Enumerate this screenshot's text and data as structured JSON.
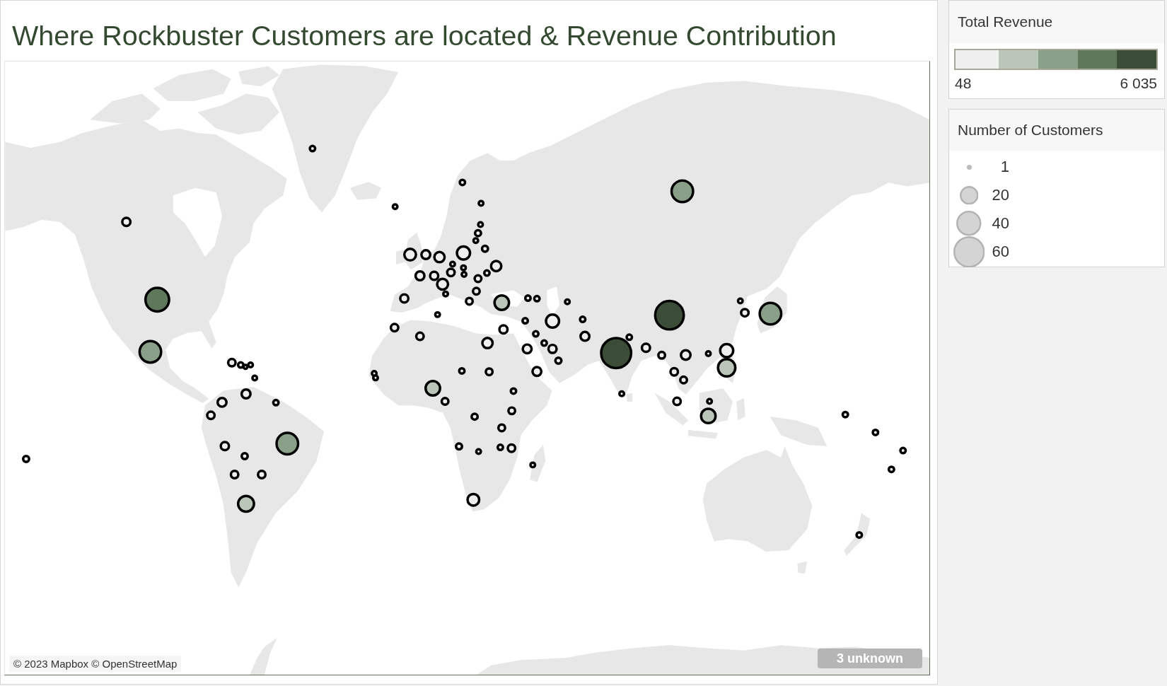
{
  "title": "Where Rockbuster Customers are located & Revenue Contribution",
  "map": {
    "attribution": "© 2023 Mapbox © OpenStreetMap",
    "unknown_badge": "3 unknown"
  },
  "legends": {
    "total_revenue": {
      "title": "Total Revenue",
      "steps": [
        {
          "color": "#efefef"
        },
        {
          "color": "#bac7b8"
        },
        {
          "color": "#8a9f88"
        },
        {
          "color": "#5f775a"
        },
        {
          "color": "#3b4d36"
        }
      ],
      "min_label": "48",
      "max_label": "6 035"
    },
    "number_of_customers": {
      "title": "Number of Customers",
      "items": [
        {
          "label": "1"
        },
        {
          "label": "20"
        },
        {
          "label": "40"
        },
        {
          "label": "60"
        }
      ]
    }
  }
}
